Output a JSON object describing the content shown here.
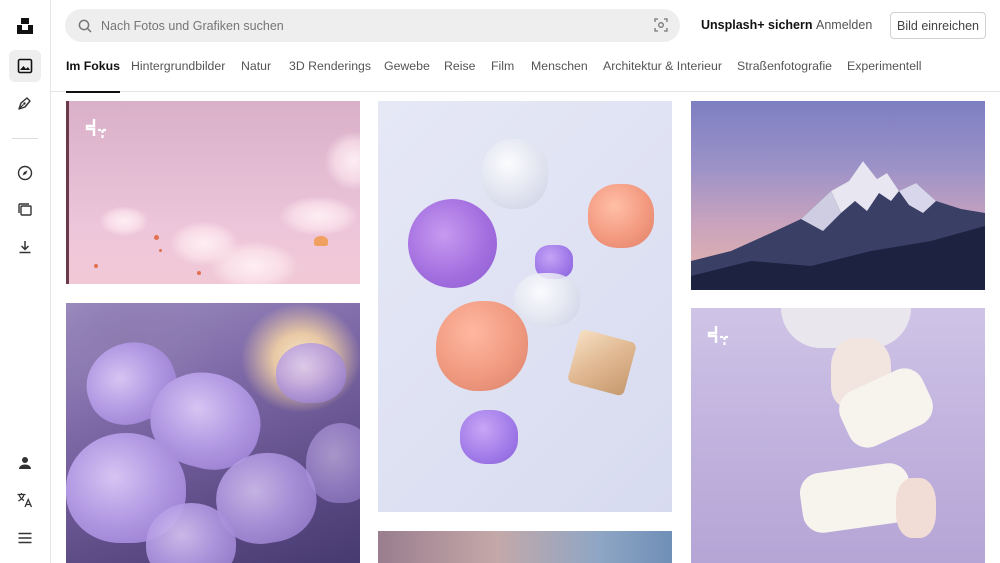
{
  "sidebar": {
    "items": [
      {
        "name": "logo",
        "icon": "unsplash-logo-icon"
      },
      {
        "name": "photos",
        "icon": "image-icon",
        "active": true
      },
      {
        "name": "illustrations",
        "icon": "pen-nib-icon"
      },
      {
        "name": "explore",
        "icon": "compass-icon"
      },
      {
        "name": "collections",
        "icon": "collections-icon"
      },
      {
        "name": "download",
        "icon": "download-icon"
      },
      {
        "name": "account",
        "icon": "user-icon"
      },
      {
        "name": "language",
        "icon": "translate-icon"
      },
      {
        "name": "menu",
        "icon": "hamburger-menu-icon"
      }
    ]
  },
  "search": {
    "placeholder": "Nach Fotos und Grafiken suchen",
    "value": ""
  },
  "header": {
    "plus_label": "Unsplash+ sichern",
    "login_label": "Anmelden",
    "submit_label": "Bild einreichen"
  },
  "tabs": [
    {
      "label": "Im Fokus",
      "active": true
    },
    {
      "label": "Hintergrundbilder"
    },
    {
      "label": "Natur"
    },
    {
      "label": "3D Renderings"
    },
    {
      "label": "Gewebe"
    },
    {
      "label": "Reise"
    },
    {
      "label": "Film"
    },
    {
      "label": "Menschen"
    },
    {
      "label": "Architektur & Interieur"
    },
    {
      "label": "Straßenfotografie"
    },
    {
      "label": "Experimentell"
    }
  ],
  "photos": [
    {
      "name": "pink-sky-paragliders-photo",
      "premium": true
    },
    {
      "name": "purple-azalea-flowers-photo",
      "premium": false
    },
    {
      "name": "pastel-3d-shapes-photo",
      "premium": false
    },
    {
      "name": "sunset-partial-photo",
      "premium": false
    },
    {
      "name": "snowy-mountain-dusk-photo",
      "premium": false
    },
    {
      "name": "lavender-sweater-hands-photo",
      "premium": true
    }
  ],
  "colors": {
    "accent": "#111111",
    "search_bg": "#eeeeee",
    "border": "#e5e5e5",
    "muted_text": "#767676"
  }
}
